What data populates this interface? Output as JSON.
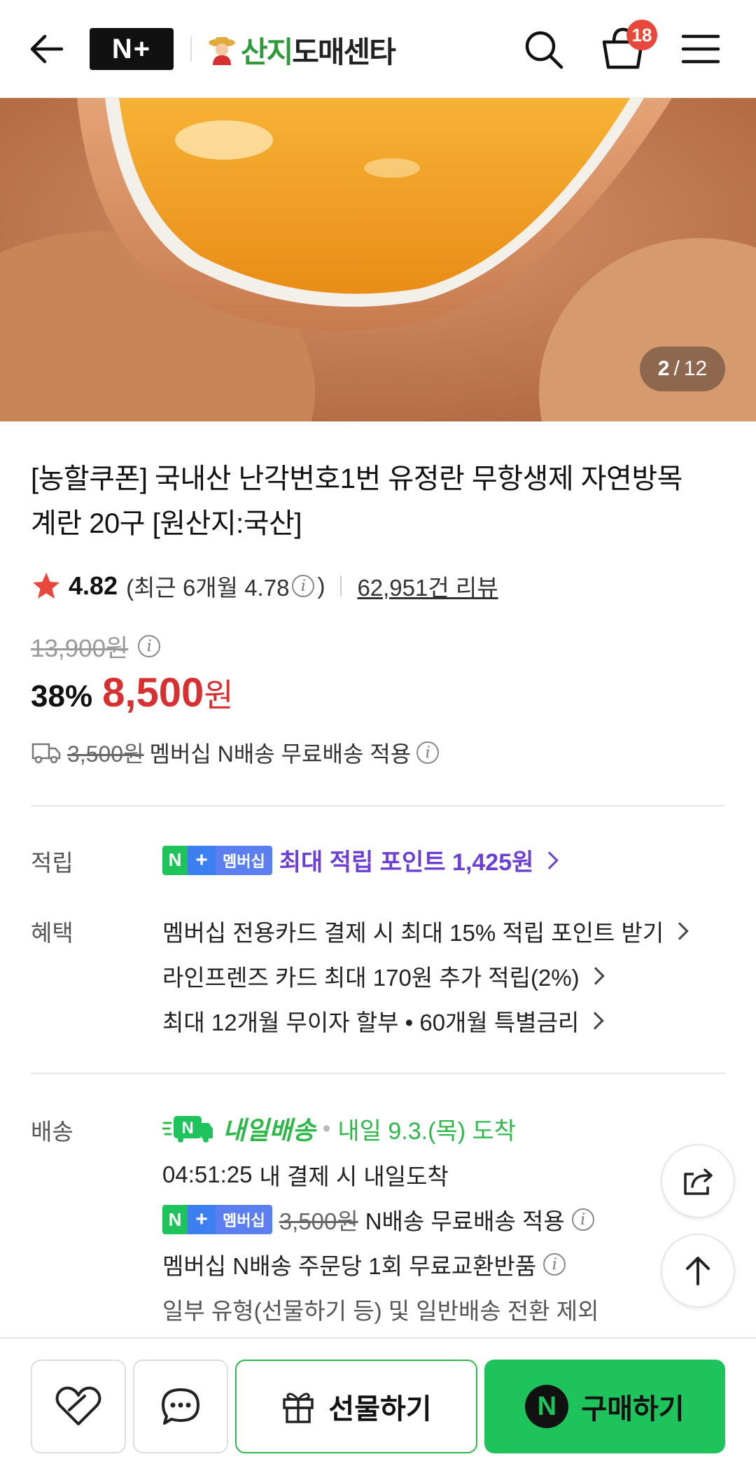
{
  "header": {
    "np_logo": "N+",
    "store_name_green": "산지",
    "store_name_dark": "도매센타",
    "cart_count": "18"
  },
  "gallery": {
    "current": "2",
    "separator": "/",
    "total": "12"
  },
  "product": {
    "title": "[농할쿠폰] 국내산 난각번호1번 유정란 무항생제 자연방목 계란 20구 [원산지:국산]",
    "rating": "4.82",
    "rating_recent_prefix": "(최근 6개월 4.78",
    "rating_recent_suffix": ")",
    "reviews": "62,951건 리뷰",
    "original_price": "13,900원",
    "discount": "38%",
    "price": "8,500",
    "price_unit": "원",
    "shipping_fee": "3,500원",
    "shipping_note": "멤버십 N배송 무료배송 적용"
  },
  "points": {
    "label": "적립",
    "badge_n": "N",
    "badge_plus": "+",
    "badge_text": "멤버십",
    "text": "최대 적립 포인트 1,425원"
  },
  "benefits": {
    "label": "혜택",
    "lines": [
      "멤버십 전용카드 결제 시 최대 15% 적립 포인트 받기",
      "라인프렌즈 카드 최대 170원 추가 적립(2%)",
      "최대 12개월 무이자 할부 • 60개월 특별금리"
    ]
  },
  "delivery": {
    "label": "배송",
    "brand": "내일배송",
    "dot": "•",
    "arrival": "내일 9.3.(목) 도착",
    "countdown": "04:51:25",
    "countdown_note": "내 결제 시 내일도착",
    "badge_text": "멤버십",
    "fee": "3,500원",
    "fee_note": "N배송 무료배송 적용",
    "exchange_note": "멤버십 N배송 주문당 1회 무료교환반품",
    "exclusion_note": "일부 유형(선물하기 등) 및 일반배송 전환 제외"
  },
  "bottom_bar": {
    "gift": "선물하기",
    "buy": "구매하기",
    "buy_logo": "N"
  },
  "colors": {
    "price_red": "#d63031",
    "naver_green": "#1fc35c",
    "points_purple": "#6b3fd4",
    "badge_red": "#e8473b"
  }
}
